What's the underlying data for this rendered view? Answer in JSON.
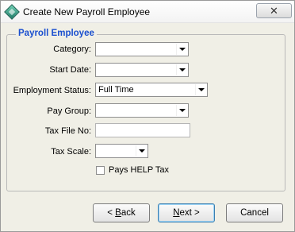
{
  "window": {
    "title": "Create New Payroll Employee",
    "close_glyph": "✕",
    "icon": "payroll-diamond-icon"
  },
  "group": {
    "legend": "Payroll Employee"
  },
  "fields": {
    "category": {
      "label": "Category:",
      "value": ""
    },
    "start_date": {
      "label": "Start Date:",
      "value": ""
    },
    "employment_status": {
      "label": "Employment Status:",
      "value": "Full Time"
    },
    "pay_group": {
      "label": "Pay Group:",
      "value": ""
    },
    "tax_file_no": {
      "label": "Tax File No:",
      "value": ""
    },
    "tax_scale": {
      "label": "Tax Scale:",
      "value": ""
    },
    "pays_help_tax": {
      "label": "Pays HELP Tax",
      "checked": false
    }
  },
  "buttons": {
    "back": {
      "mnemonic": "B",
      "rest": "ack",
      "prefix": "< "
    },
    "next": {
      "mnemonic": "N",
      "rest": "ext >"
    },
    "cancel": {
      "label": "Cancel"
    }
  },
  "colors": {
    "legend": "#1a4fcf",
    "dialog_bg": "#f0efe6"
  }
}
